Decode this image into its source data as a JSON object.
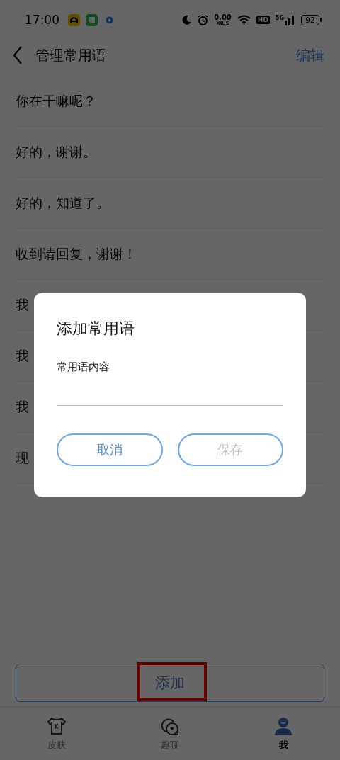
{
  "status_bar": {
    "time": "17:00",
    "network_speed": "0.00",
    "network_speed_unit": "KB/S",
    "hd": "HD",
    "network_type": "5G",
    "battery": "92"
  },
  "header": {
    "title": "管理常用语",
    "action": "编辑"
  },
  "phrases": [
    "你在干嘛呢？",
    "好的，谢谢。",
    "好的，知道了。",
    "收到请回复，谢谢！",
    "我",
    "我",
    "我",
    "现"
  ],
  "add_button": {
    "label": "添加",
    "highlighted": true
  },
  "bottom_nav": [
    {
      "label": "皮肤",
      "selected": false
    },
    {
      "label": "趣聊",
      "selected": false
    },
    {
      "label": "我",
      "selected": true
    }
  ],
  "dialog": {
    "title": "添加常用语",
    "field_label": "常用语内容",
    "buttons": [
      {
        "label": "取消",
        "disabled": false
      },
      {
        "label": "保存",
        "disabled": true
      }
    ]
  }
}
